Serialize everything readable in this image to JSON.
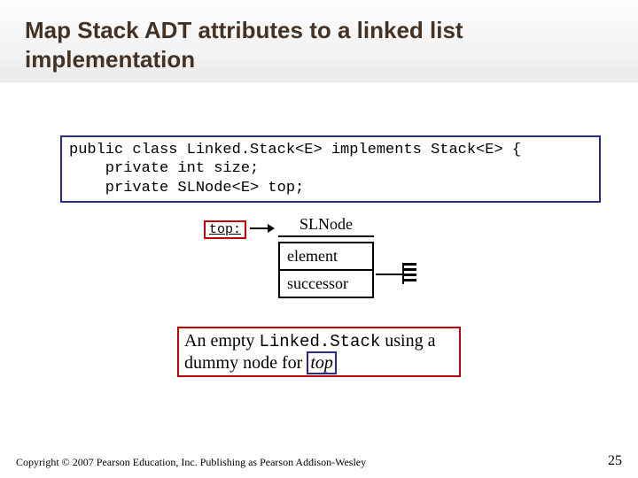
{
  "title": "Map Stack ADT attributes to a linked list implementation",
  "code": {
    "line1": "public class Linked.Stack<E> implements Stack<E> {",
    "line2": "    private int size;",
    "line3": "    private SLNode<E> top;"
  },
  "diagram": {
    "top_label": "top:",
    "class_name": "SLNode",
    "field1": "element",
    "field2": "successor"
  },
  "caption": {
    "prefix": "An empty ",
    "classname": "Linked.Stack",
    "mid": " using a dummy node for ",
    "top_word": "top"
  },
  "footer": {
    "copyright": "Copyright © 2007 Pearson Education, Inc. Publishing as Pearson Addison-Wesley",
    "page": "25"
  }
}
